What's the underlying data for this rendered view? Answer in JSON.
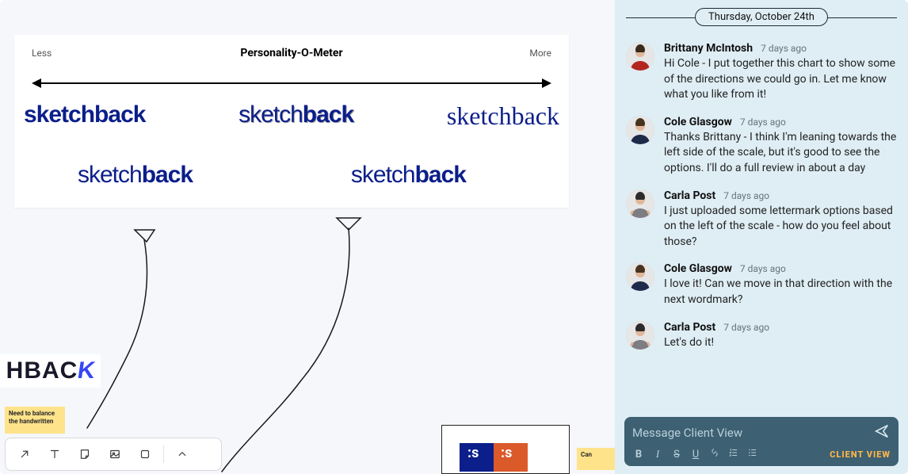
{
  "canvas": {
    "meter": {
      "left_label": "Less",
      "title": "Personality-O-Meter",
      "right_label": "More",
      "row1": {
        "logo_a": "sketchback",
        "logo_b_pre": "sketch",
        "logo_b_bold": "back",
        "logo_c": "sketchback"
      },
      "row2": {
        "logo_d_pre": "sketch",
        "logo_d_bold": "back",
        "logo_e_pre": "sketch",
        "logo_e_bold": "back"
      }
    },
    "lettermark": {
      "visible_left": "HBAC",
      "visible_k": "K"
    },
    "sticky1": "Need to balance the handwritten",
    "sticky2": "Can",
    "preview": {
      "glyph1": ":s",
      "glyph2": ":s"
    }
  },
  "toolbar": {
    "arrow": "open",
    "text": "T",
    "note": "note",
    "image": "image",
    "shape": "shape",
    "more": "more"
  },
  "chat": {
    "date": "Thursday, October 24th",
    "messages": [
      {
        "name": "Brittany McIntosh",
        "time": "7 days ago",
        "text": "Hi Cole - I put together this chart to show some of the directions we could go in. Let me know what you like from it!",
        "avatar": "red"
      },
      {
        "name": "Cole Glasgow",
        "time": "7 days ago",
        "text": "Thanks Brittany - I think I'm leaning towards the left side of the scale, but it's good to see the options. I'll do a full review in about a day",
        "avatar": "navy"
      },
      {
        "name": "Carla Post",
        "time": "7 days ago",
        "text": "I just uploaded some lettermark options based on the left of the scale - how do you feel about those?",
        "avatar": "grey"
      },
      {
        "name": "Cole Glasgow",
        "time": "7 days ago",
        "text": "I love it! Can we move in that direction with the next wordmark?",
        "avatar": "navy"
      },
      {
        "name": "Carla Post",
        "time": "7 days ago",
        "text": "Let's do it!",
        "avatar": "grey"
      }
    ],
    "composer": {
      "placeholder": "Message Client View",
      "client_view": "CLIENT VIEW",
      "fmt": {
        "bold": "B",
        "italic": "I",
        "strike": "S",
        "underline": "U"
      }
    }
  }
}
